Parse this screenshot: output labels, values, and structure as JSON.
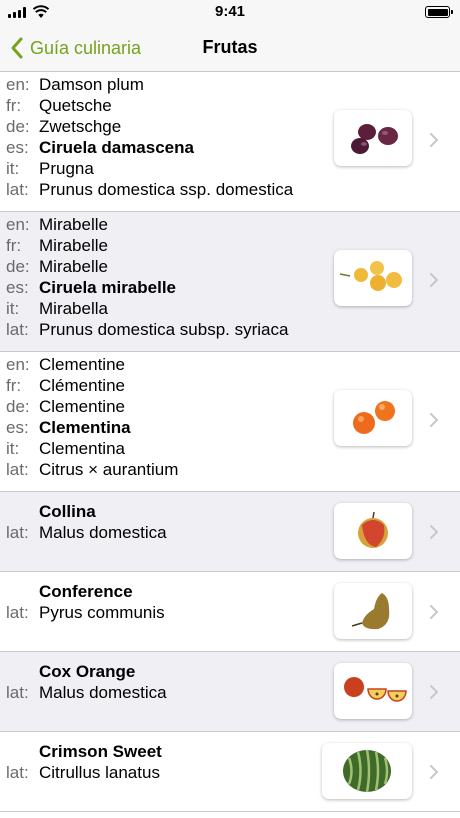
{
  "status_bar": {
    "time": "9:41"
  },
  "nav": {
    "back_label": "Guía culinaria",
    "title": "Frutas"
  },
  "fruits": [
    {
      "lines": [
        {
          "lang": "en:",
          "name": "Damson plum"
        },
        {
          "lang": "fr:",
          "name": "Quetsche"
        },
        {
          "lang": "de:",
          "name": "Zwetschge"
        },
        {
          "lang": "es:",
          "name": "Ciruela damascena"
        },
        {
          "lang": "it:",
          "name": "Prugna"
        },
        {
          "lang": "lat:",
          "name": "Prunus domestica ssp. domestica"
        }
      ]
    },
    {
      "lines": [
        {
          "lang": "en:",
          "name": "Mirabelle"
        },
        {
          "lang": "fr:",
          "name": "Mirabelle"
        },
        {
          "lang": "de:",
          "name": "Mirabelle"
        },
        {
          "lang": "es:",
          "name": "Ciruela mirabelle"
        },
        {
          "lang": "it:",
          "name": "Mirabella"
        },
        {
          "lang": "lat:",
          "name": "Prunus domestica subsp. syriaca"
        }
      ]
    },
    {
      "lines": [
        {
          "lang": "en:",
          "name": "Clementine"
        },
        {
          "lang": "fr:",
          "name": "Clémentine"
        },
        {
          "lang": "de:",
          "name": "Clementine"
        },
        {
          "lang": "es:",
          "name": "Clementina"
        },
        {
          "lang": "it:",
          "name": "Clementina"
        },
        {
          "lang": "lat:",
          "name": "Citrus × aurantium"
        }
      ]
    },
    {
      "title": "Collina",
      "lat_label": "lat:",
      "latin": "Malus domestica"
    },
    {
      "title": "Conference",
      "lat_label": "lat:",
      "latin": "Pyrus communis"
    },
    {
      "title": "Cox Orange",
      "lat_label": "lat:",
      "latin": "Malus domestica"
    },
    {
      "title": "Crimson Sweet",
      "lat_label": "lat:",
      "latin": "Citrullus lanatus"
    }
  ],
  "colors": {
    "accent": "#76a21c",
    "shaded_row": "#efeff4",
    "nav_bg": "#f7f7f7"
  }
}
